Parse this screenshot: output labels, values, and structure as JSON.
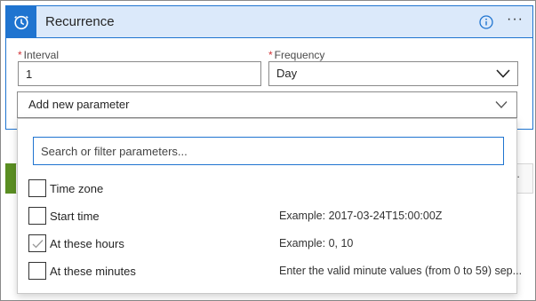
{
  "card": {
    "title": "Recurrence",
    "accent_color": "#1f74d0",
    "header_bg": "#dbe9fa",
    "icons": [
      "alarm-clock-icon",
      "info-icon",
      "more-icon"
    ],
    "more_label": "···"
  },
  "interval": {
    "label": "Interval",
    "required_mark": "*",
    "value": "1"
  },
  "frequency": {
    "label": "Frequency",
    "required_mark": "*",
    "value": "Day"
  },
  "add_parameter": {
    "label": "Add new parameter"
  },
  "dropdown": {
    "search_placeholder": "Search or filter parameters...",
    "items": [
      {
        "name": "Time zone",
        "example": "",
        "checked": false
      },
      {
        "name": "Start time",
        "example": "Example: 2017-03-24T15:00:00Z",
        "checked": false
      },
      {
        "name": "At these hours",
        "example": "Example: 0, 10",
        "checked": true
      },
      {
        "name": "At these minutes",
        "example": "Enter the valid minute values (from 0 to 59) sep...",
        "checked": false
      }
    ]
  },
  "background_card": {
    "accent_color": "#5a8e22",
    "more_label": "·"
  }
}
